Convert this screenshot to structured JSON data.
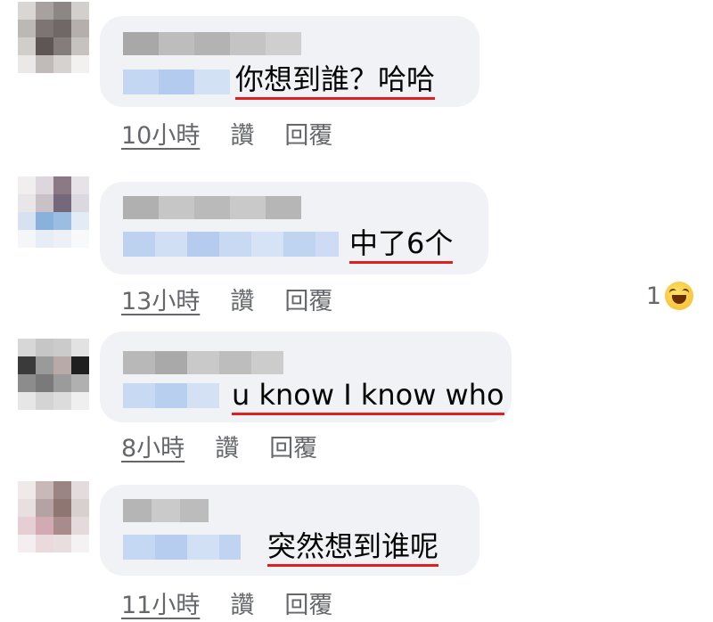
{
  "comments": [
    {
      "text": "你想到誰？哈哈",
      "time": "10小時",
      "like": "讚",
      "reply": "回覆"
    },
    {
      "text": "中了6个",
      "time": "13小時",
      "like": "讚",
      "reply": "回覆",
      "reaction_count": "1",
      "reaction_icon": "laughing-emoji-icon"
    },
    {
      "text": "u know I know who",
      "time": "8小時",
      "like": "讚",
      "reply": "回覆"
    },
    {
      "text": "突然想到谁呢",
      "time": "11小時",
      "like": "讚",
      "reply": "回覆"
    }
  ],
  "colors": {
    "bubble": "#f0f2f5",
    "meta_text": "#65676b",
    "underline": "#e02020",
    "mention_blur": "#c4d7f2"
  }
}
